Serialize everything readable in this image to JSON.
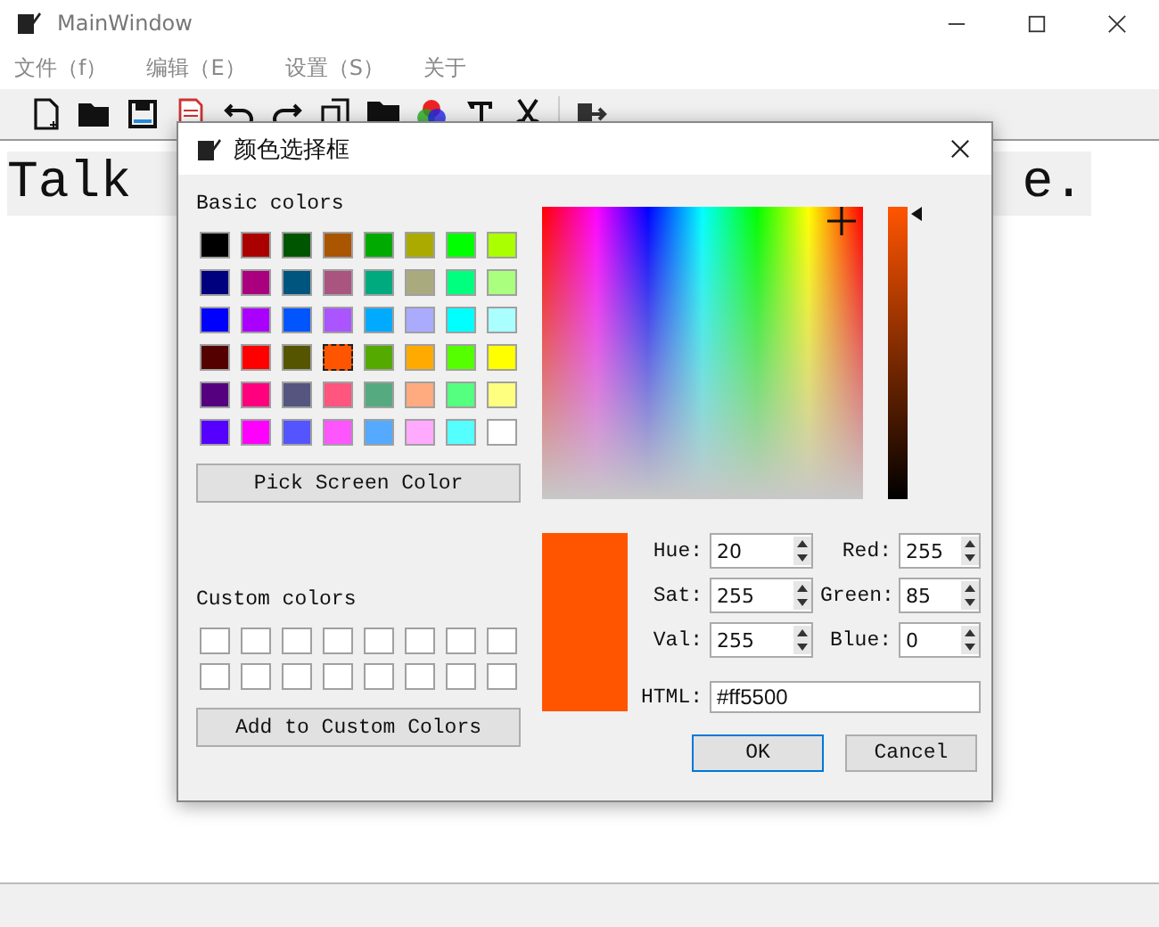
{
  "window": {
    "title": "MainWindow"
  },
  "menu": [
    "文件（f）",
    "编辑（E）",
    "设置（S）",
    "关于"
  ],
  "editor": {
    "visible_text": [
      "Talk",
      "e."
    ]
  },
  "dialog": {
    "title": "颜色选择框",
    "basic_colors_label": "Basic colors",
    "basic_colors": [
      {
        "color": "#000000",
        "selected": false
      },
      {
        "color": "#aa0000",
        "selected": false
      },
      {
        "color": "#005500",
        "selected": false
      },
      {
        "color": "#aa5500",
        "selected": false
      },
      {
        "color": "#00aa00",
        "selected": false
      },
      {
        "color": "#aaaa00",
        "selected": false
      },
      {
        "color": "#00ff00",
        "selected": false
      },
      {
        "color": "#aaff00",
        "selected": false
      },
      {
        "color": "#00007f",
        "selected": false
      },
      {
        "color": "#aa007f",
        "selected": false
      },
      {
        "color": "#00557f",
        "selected": false
      },
      {
        "color": "#aa557f",
        "selected": false
      },
      {
        "color": "#00aa7f",
        "selected": false
      },
      {
        "color": "#aaaa7f",
        "selected": false
      },
      {
        "color": "#00ff7f",
        "selected": false
      },
      {
        "color": "#aaff7f",
        "selected": false
      },
      {
        "color": "#0000ff",
        "selected": false
      },
      {
        "color": "#aa00ff",
        "selected": false
      },
      {
        "color": "#0055ff",
        "selected": false
      },
      {
        "color": "#aa55ff",
        "selected": false
      },
      {
        "color": "#00aaff",
        "selected": false
      },
      {
        "color": "#aaaaff",
        "selected": false
      },
      {
        "color": "#00ffff",
        "selected": false
      },
      {
        "color": "#aaffff",
        "selected": false
      },
      {
        "color": "#550000",
        "selected": false
      },
      {
        "color": "#ff0000",
        "selected": false
      },
      {
        "color": "#555500",
        "selected": false
      },
      {
        "color": "#ff5500",
        "selected": true
      },
      {
        "color": "#55aa00",
        "selected": false
      },
      {
        "color": "#ffaa00",
        "selected": false
      },
      {
        "color": "#55ff00",
        "selected": false
      },
      {
        "color": "#ffff00",
        "selected": false
      },
      {
        "color": "#55007f",
        "selected": false
      },
      {
        "color": "#ff007f",
        "selected": false
      },
      {
        "color": "#55557f",
        "selected": false
      },
      {
        "color": "#ff557f",
        "selected": false
      },
      {
        "color": "#55aa7f",
        "selected": false
      },
      {
        "color": "#ffaa7f",
        "selected": false
      },
      {
        "color": "#55ff7f",
        "selected": false
      },
      {
        "color": "#ffff7f",
        "selected": false
      },
      {
        "color": "#5500ff",
        "selected": false
      },
      {
        "color": "#ff00ff",
        "selected": false
      },
      {
        "color": "#5555ff",
        "selected": false
      },
      {
        "color": "#ff55ff",
        "selected": false
      },
      {
        "color": "#55aaff",
        "selected": false
      },
      {
        "color": "#ffaaff",
        "selected": false
      },
      {
        "color": "#55ffff",
        "selected": false
      },
      {
        "color": "#ffffff",
        "selected": false
      }
    ],
    "pick_button": "Pick Screen Color",
    "custom_colors_label": "Custom colors",
    "add_button": "Add to Custom Colors",
    "value_slider": {
      "level": 1
    },
    "fields": [
      {
        "label": "Hue:",
        "value": "20"
      },
      {
        "label": "Red:",
        "value": "255"
      },
      {
        "label": "Sat:",
        "value": "255"
      },
      {
        "label": "Green:",
        "value": "85"
      },
      {
        "label": "Val:",
        "value": "255"
      },
      {
        "label": "Blue:",
        "value": "0"
      }
    ],
    "html": {
      "label": "HTML:",
      "value": "#ff5500"
    },
    "buttons": [
      {
        "label": "OK",
        "default": true
      },
      {
        "label": "Cancel",
        "default": false
      }
    ]
  }
}
